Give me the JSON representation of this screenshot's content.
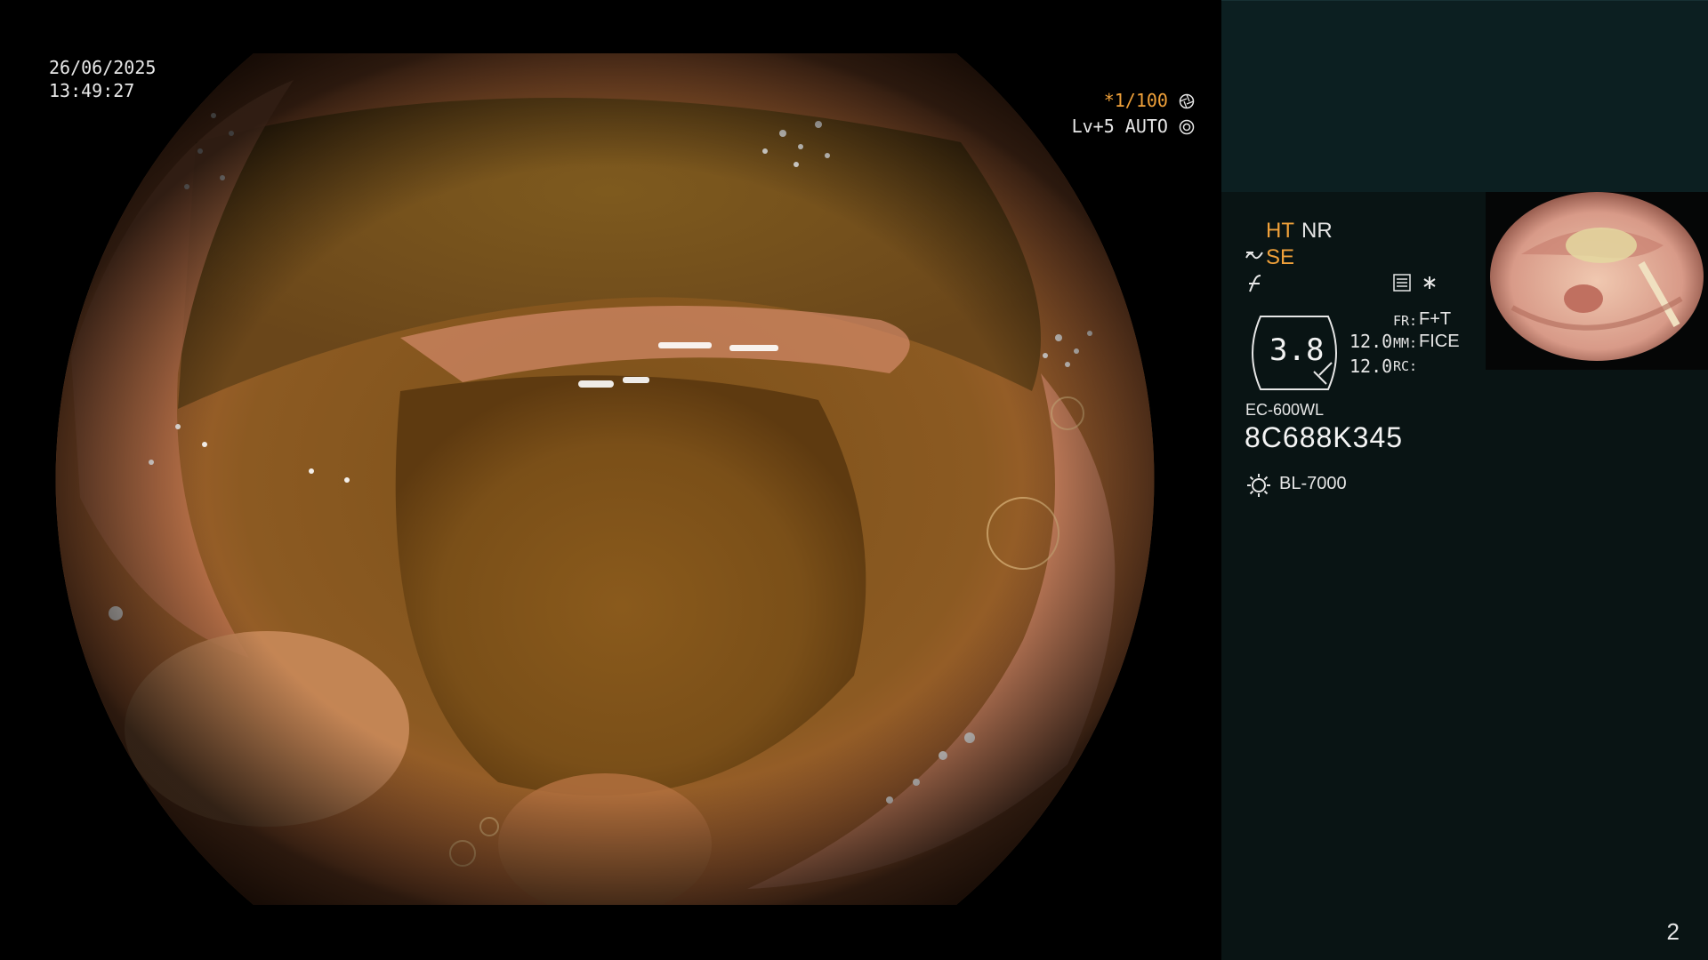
{
  "overlay": {
    "date": "26/06/2025",
    "time": "13:49:27",
    "shutter": "*1/100",
    "iris": "Lv+5 AUTO"
  },
  "settings": {
    "ht": "HT",
    "nr": "NR",
    "se": "SE",
    "zoom": "3.8",
    "value_a": "12.0",
    "value_b": "12.0",
    "fr_label": "FR:",
    "fr_value": "F+T",
    "mm_label": "MM:",
    "mm_value": "FICE",
    "rc_label": "RC:"
  },
  "scope": {
    "model": "EC-600WL",
    "serial": "8C688K345",
    "light_source": "BL-7000"
  },
  "page_number": "2",
  "colors": {
    "accent_orange": "#f0a13a",
    "panel_bg": "#0a1616",
    "panel_top": "#0c1f21"
  },
  "icons": [
    "aperture-icon",
    "iris-icon",
    "se-curve-icon",
    "f-curve-icon",
    "menu-icon",
    "asterisk-icon",
    "lamp-icon"
  ]
}
